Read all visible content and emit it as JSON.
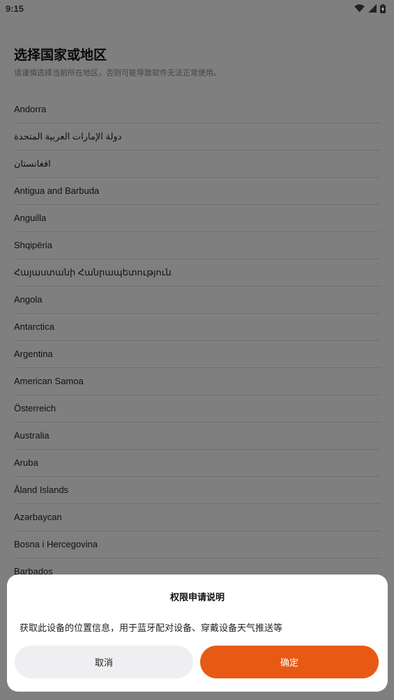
{
  "status_bar": {
    "time": "9:15",
    "icons": [
      "wifi-icon",
      "cellular-signal-icon",
      "battery-icon"
    ]
  },
  "page": {
    "title": "选择国家或地区",
    "subtitle": "请谨慎选择当前所在地区，否则可能导致软件无法正常使用。"
  },
  "countries": [
    "Andorra",
    "دولة الإمارات العربية المتحدة",
    "افغانستان",
    "Antigua and Barbuda",
    "Anguilla",
    "Shqipëria",
    "Հայաստանի Հանրապետություն",
    "Angola",
    "Antarctica",
    "Argentina",
    "American Samoa",
    "Österreich",
    "Australia",
    "Aruba",
    "Åland Islands",
    "Azərbaycan",
    "Bosna i Hercegovina",
    "Barbados"
  ],
  "dialog": {
    "title": "权限申请说明",
    "message": "获取此设备的位置信息，用于蓝牙配对设备、穿戴设备天气推送等",
    "cancel_label": "取消",
    "confirm_label": "确定"
  },
  "colors": {
    "accent": "#e85a13",
    "cancel_bg": "#efeff2",
    "scrim": "rgba(0,0,0,0.5)"
  }
}
